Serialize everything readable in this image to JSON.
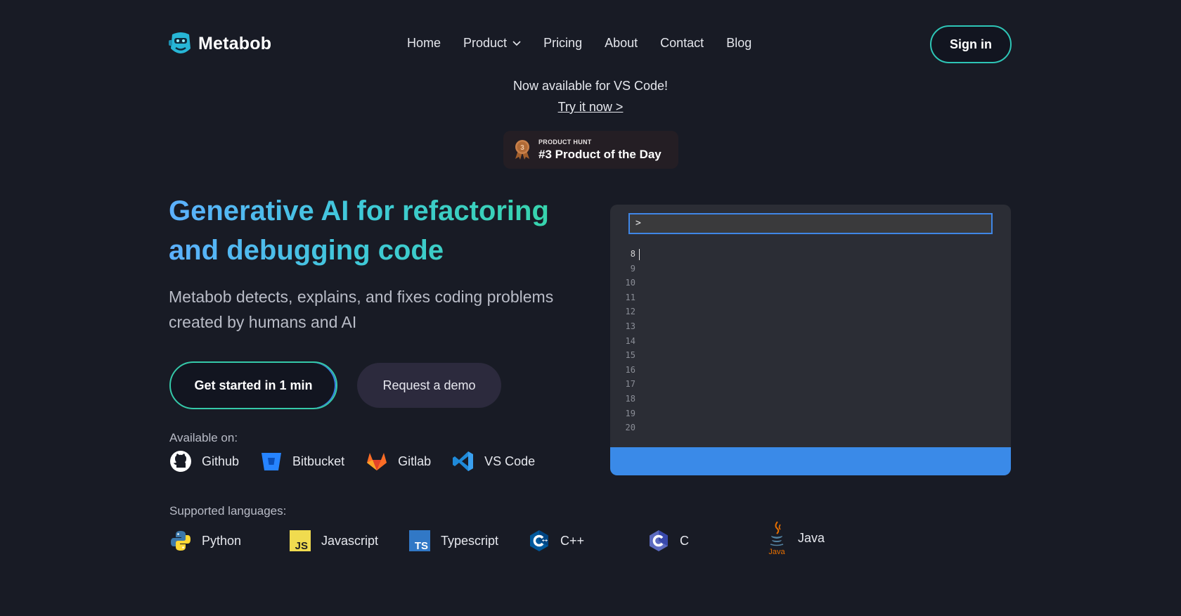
{
  "header": {
    "logo_text": "Metabob",
    "nav": [
      {
        "label": "Home"
      },
      {
        "label": "Product"
      },
      {
        "label": "Pricing"
      },
      {
        "label": "About"
      },
      {
        "label": "Contact"
      },
      {
        "label": "Blog"
      }
    ],
    "sign_in": "Sign in"
  },
  "announcement": {
    "text": "Now available for VS Code!",
    "link": "Try it now >"
  },
  "product_hunt": {
    "medal_number": "3",
    "small": "PRODUCT HUNT",
    "big": "#3 Product of the Day"
  },
  "hero": {
    "title": "Generative AI for refactoring and debugging code",
    "subtitle": "Metabob detects, explains, and fixes coding problems created by humans and AI",
    "primary_button": "Get started in 1 min",
    "secondary_button": "Request a demo"
  },
  "available": {
    "label": "Available on:",
    "platforms": [
      {
        "name": "Github",
        "icon": "github-icon"
      },
      {
        "name": "Bitbucket",
        "icon": "bitbucket-icon"
      },
      {
        "name": "Gitlab",
        "icon": "gitlab-icon"
      },
      {
        "name": "VS Code",
        "icon": "vscode-icon"
      }
    ]
  },
  "languages": {
    "label": "Supported languages:",
    "items": [
      {
        "name": "Python",
        "icon": "python-icon"
      },
      {
        "name": "Javascript",
        "icon": "javascript-icon"
      },
      {
        "name": "Typescript",
        "icon": "typescript-icon"
      },
      {
        "name": "C++",
        "icon": "cplusplus-icon"
      },
      {
        "name": "C",
        "icon": "c-icon"
      },
      {
        "name": "Java",
        "icon": "java-icon"
      }
    ],
    "java_logo_text": "Java"
  },
  "editor": {
    "prompt": ">",
    "line_numbers": [
      "8",
      "9",
      "10",
      "11",
      "12",
      "13",
      "14",
      "15",
      "16",
      "17",
      "18",
      "19",
      "20"
    ],
    "active_line": "8"
  },
  "colors": {
    "background": "#181b25",
    "accent_teal": "#2ec5b6",
    "accent_blue": "#3a8ae8",
    "title_gradient_start": "#5cb0ff",
    "title_gradient_end": "#35d6a3"
  }
}
